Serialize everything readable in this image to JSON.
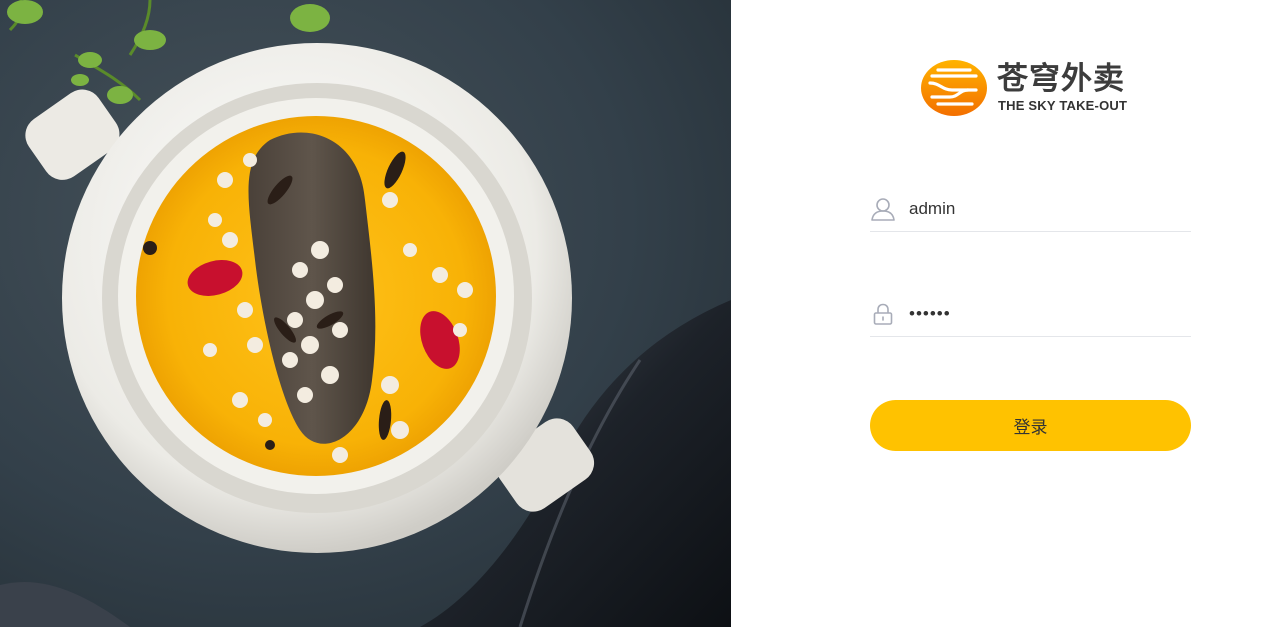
{
  "brand": {
    "title": "苍穹外卖",
    "subtitle": "THE SKY TAKE-OUT",
    "logo_icon": "cloud-logo-icon",
    "accent_color": "#ffc200",
    "logo_color": "#f58a00"
  },
  "form": {
    "username": {
      "icon": "user-icon",
      "value": "admin"
    },
    "password": {
      "icon": "lock-icon",
      "value": "••••••"
    },
    "submit_label": "登录"
  }
}
